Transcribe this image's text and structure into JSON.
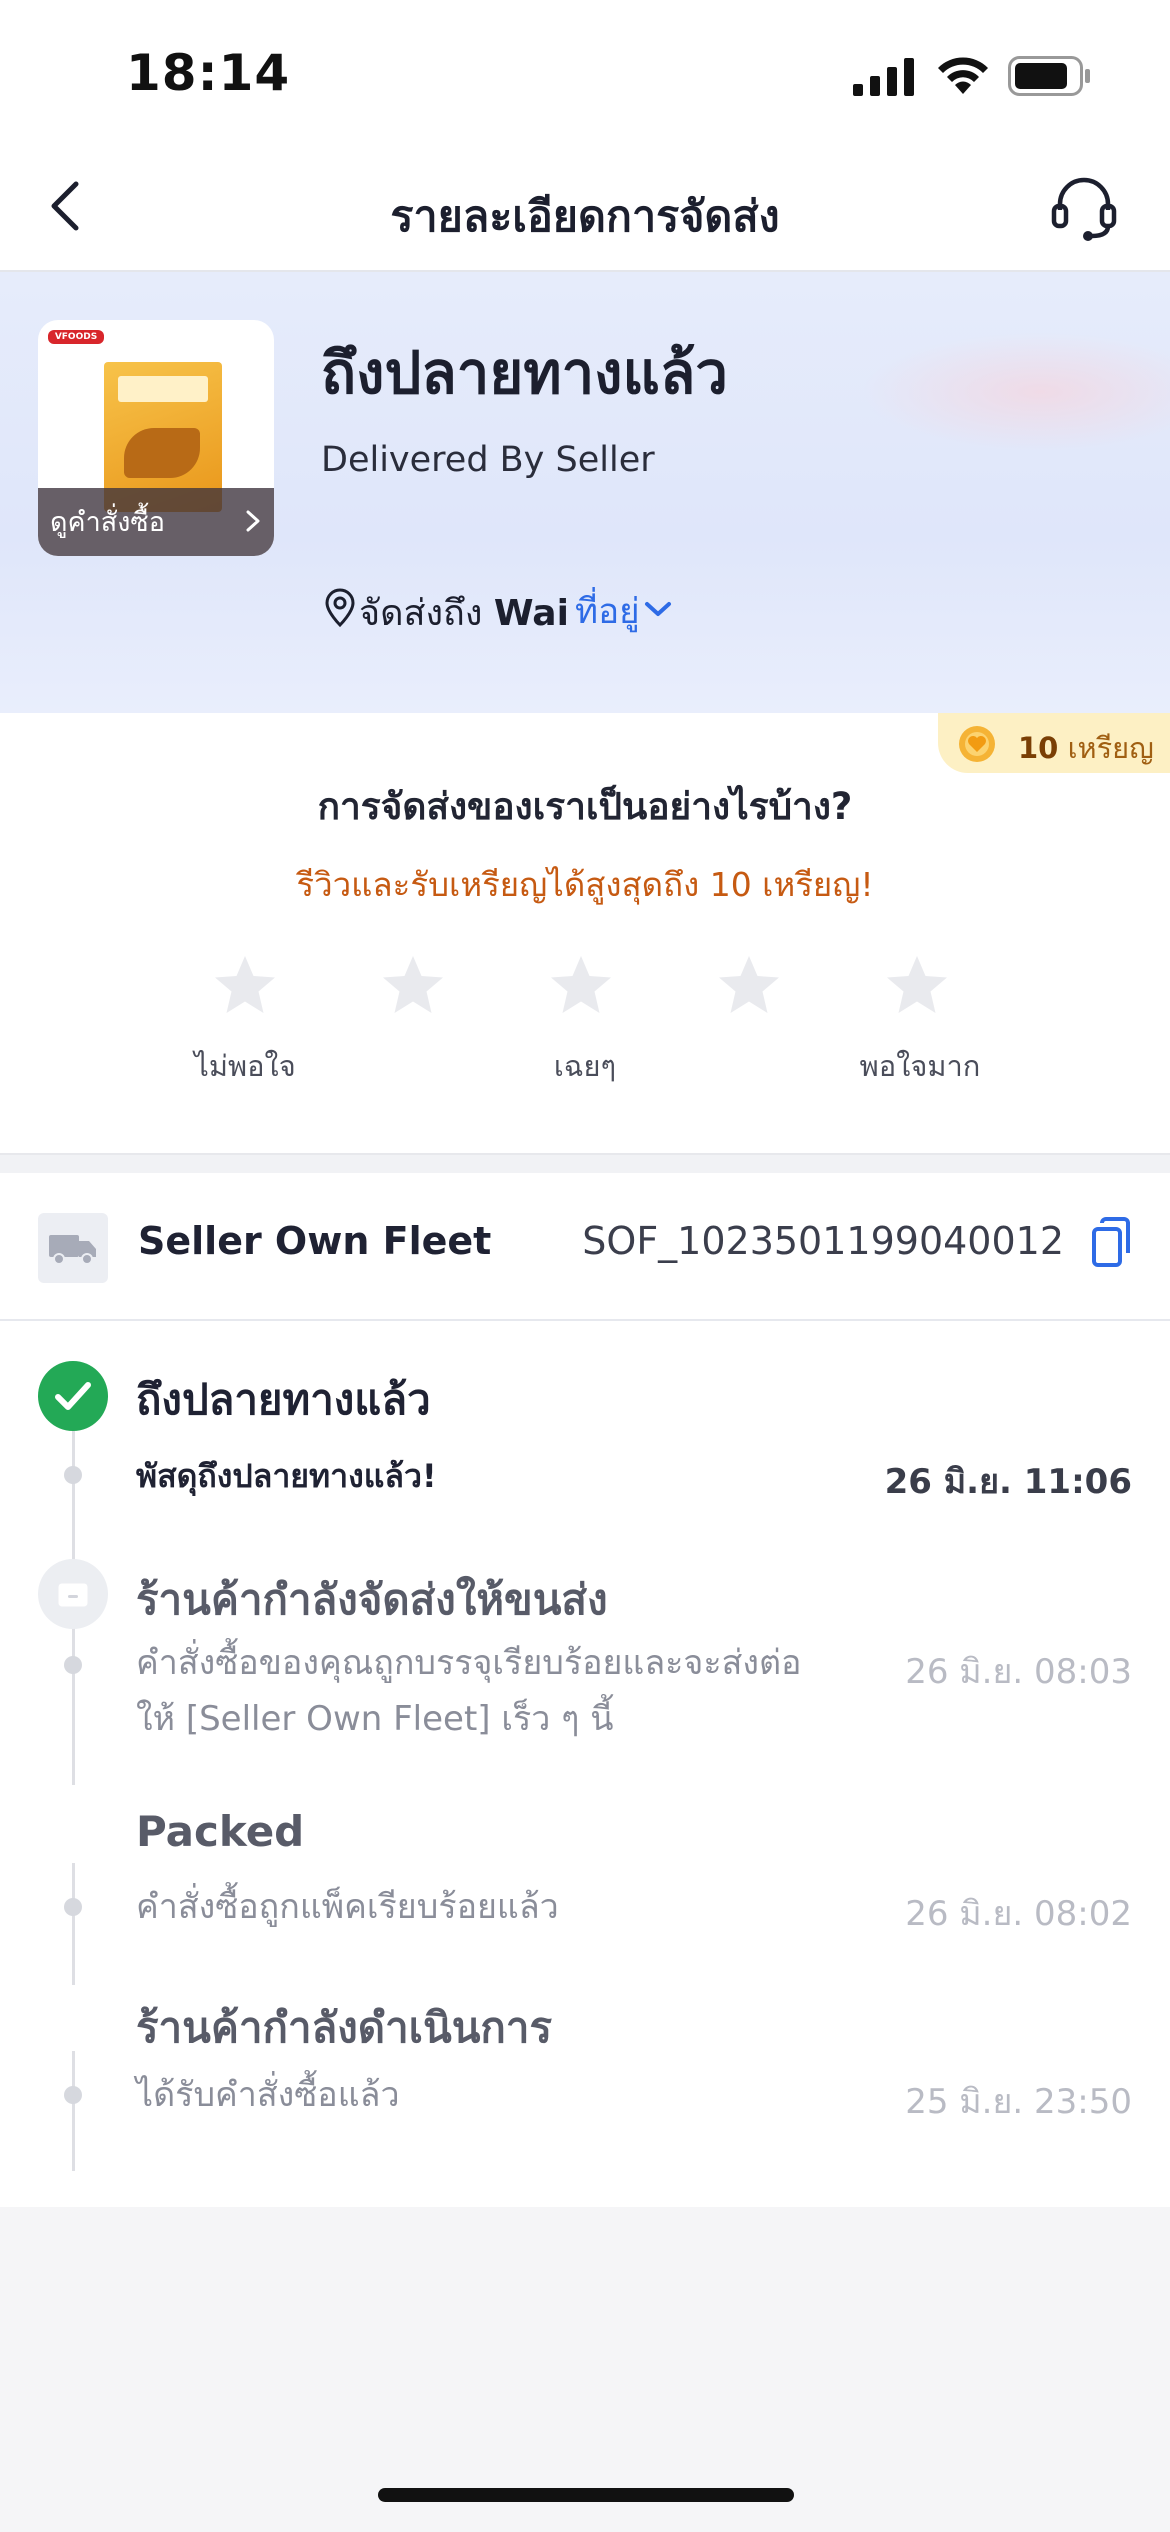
{
  "status_bar": {
    "time": "18:14"
  },
  "nav": {
    "title": "รายละเอียดการจัดส่ง"
  },
  "hero": {
    "status_title": "ถึงปลายทางแล้ว",
    "subtitle": "Delivered By Seller",
    "view_order_label": "ดูคำสั่งซื้อ",
    "product_brand": "VFOODS",
    "ship_to_prefix": "จัดส่งถึง",
    "ship_to_name": "Wai",
    "address_link": "ที่อยู่"
  },
  "review": {
    "coin_amount": "10",
    "coin_unit": "เหรียญ",
    "question": "การจัดส่งของเราเป็นอย่างไรบ้าง?",
    "promo": "รีวิวและรับเหรียญได้สูงสุดถึง 10 เหรียญ!",
    "star_count": 5,
    "star_color": "#e9eaee",
    "labels": {
      "low": "ไม่พอใจ",
      "mid": "เฉยๆ",
      "high": "พอใจมาก"
    }
  },
  "carrier": {
    "name": "Seller Own Fleet",
    "tracking_number": "SOF_1023501199040012"
  },
  "timeline": [
    {
      "title": "ถึงปลายทางแล้ว",
      "icon": "check-circle-icon",
      "events": [
        {
          "desc": "พัสดุถึงปลายทางแล้ว!",
          "time": "26 มิ.ย. 11:06"
        }
      ]
    },
    {
      "title": "ร้านค้ากำลังจัดส่งให้ขนส่ง",
      "icon": "package-icon",
      "events": [
        {
          "desc": "คำสั่งซื้อของคุณถูกบรรจุเรียบร้อยและจะส่งต่อให้ [Seller Own Fleet] เร็ว ๆ นี้",
          "time": "26 มิ.ย. 08:03"
        }
      ]
    },
    {
      "title": "Packed",
      "events": [
        {
          "desc": "คำสั่งซื้อถูกแพ็คเรียบร้อยแล้ว",
          "time": "26 มิ.ย. 08:02"
        }
      ]
    },
    {
      "title": "ร้านค้ากำลังดำเนินการ",
      "events": [
        {
          "desc": "ได้รับคำสั่งซื้อแล้ว",
          "time": "25 มิ.ย. 23:50"
        }
      ]
    }
  ],
  "colors": {
    "accent_blue": "#2e6be6",
    "success_green": "#23a956",
    "promo_orange": "#c65a12",
    "coin_badge_bg": "#fdf0c4"
  }
}
